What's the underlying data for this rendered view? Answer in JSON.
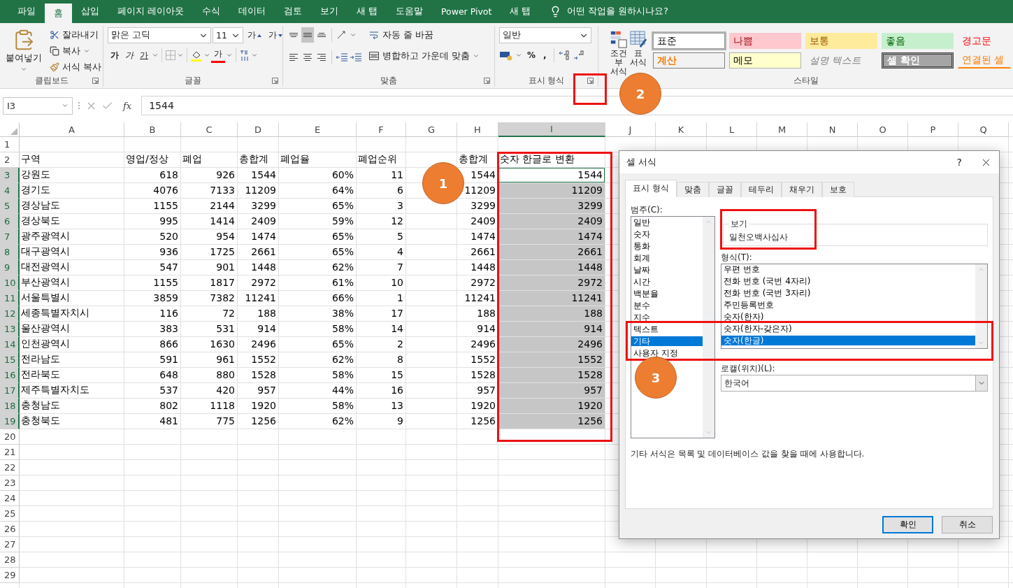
{
  "ribbon_tabs": [
    {
      "label": "파일",
      "selected": false
    },
    {
      "label": "홈",
      "selected": true
    },
    {
      "label": "삽입",
      "selected": false
    },
    {
      "label": "페이지 레이아웃",
      "selected": false
    },
    {
      "label": "수식",
      "selected": false
    },
    {
      "label": "데이터",
      "selected": false
    },
    {
      "label": "검토",
      "selected": false
    },
    {
      "label": "보기",
      "selected": false
    },
    {
      "label": "새 탭",
      "selected": false
    },
    {
      "label": "도움말",
      "selected": false
    },
    {
      "label": "Power Pivot",
      "selected": false
    },
    {
      "label": "새 탭",
      "selected": false
    }
  ],
  "tell_me": "어떤 작업을 원하시나요?",
  "ribbon": {
    "clipboard": {
      "title": "클립보드",
      "paste": "붙여넣기",
      "cut": "잘라내기",
      "copy": "복사",
      "format_painter": "서식 복사"
    },
    "font": {
      "title": "글꼴",
      "font_name": "맑은 고딕",
      "font_size": "11",
      "grow": "가",
      "shrink": "가",
      "bold": "가",
      "italic": "가",
      "underline": "가",
      "font_color": "가"
    },
    "alignment": {
      "title": "맞춤",
      "vertical_align_buttons": [
        {
          "selected": false
        },
        {
          "selected": true
        },
        {
          "selected": false
        }
      ],
      "wrap_text": "자동 줄 바꿈",
      "merge_center": "병합하고 가운데 맞춤"
    },
    "number": {
      "title": "표시 형식",
      "format": "일반",
      "percent": "%",
      "comma": ","
    },
    "styles": {
      "title": "스타일",
      "conditional": "조건부 서식",
      "table": "표 서식",
      "gallery": [
        {
          "label": "표준",
          "kind": "normal",
          "selected": true
        },
        {
          "label": "나쁨",
          "kind": "bad",
          "selected": false
        },
        {
          "label": "보통",
          "kind": "neutral",
          "selected": false
        },
        {
          "label": "좋음",
          "kind": "good",
          "selected": false
        },
        {
          "label": "경고문",
          "kind": "warning",
          "selected": false
        },
        {
          "label": "계산",
          "kind": "calculation",
          "selected": false
        },
        {
          "label": "메모",
          "kind": "note",
          "selected": false
        },
        {
          "label": "설명 텍스트",
          "kind": "explanatory",
          "selected": false
        },
        {
          "label": "셀 확인",
          "kind": "check",
          "selected": false
        },
        {
          "label": "연결된 셀",
          "kind": "linked",
          "selected": false
        }
      ]
    }
  },
  "formula_bar": {
    "name_box": "I3",
    "function_label": "fx",
    "value": "1544"
  },
  "sheet": {
    "columns": [
      {
        "label": "A",
        "selected": false
      },
      {
        "label": "B",
        "selected": false
      },
      {
        "label": "C",
        "selected": false
      },
      {
        "label": "D",
        "selected": false
      },
      {
        "label": "E",
        "selected": false
      },
      {
        "label": "F",
        "selected": false
      },
      {
        "label": "G",
        "selected": false
      },
      {
        "label": "H",
        "selected": false
      },
      {
        "label": "I",
        "selected": true
      },
      {
        "label": "J",
        "selected": false
      },
      {
        "label": "K",
        "selected": false
      },
      {
        "label": "L",
        "selected": false
      },
      {
        "label": "M",
        "selected": false
      },
      {
        "label": "N",
        "selected": false
      },
      {
        "label": "O",
        "selected": false
      },
      {
        "label": "P",
        "selected": false
      },
      {
        "label": "Q",
        "selected": false
      }
    ],
    "rows": [
      {
        "number": "1",
        "kind": "empty",
        "selected": false,
        "active": false
      },
      {
        "number": "2",
        "kind": "header",
        "selected": false,
        "active": false,
        "cells": [
          "구역",
          "영업/정상",
          "폐업",
          "총합계",
          "폐업율",
          "폐업순위"
        ],
        "h": "총합계",
        "i": "숫자 한글로 변환"
      },
      {
        "number": "3",
        "kind": "data",
        "selected": true,
        "active": true,
        "cells": [
          "강원도",
          "618",
          "926",
          "1544",
          "60%",
          "11"
        ],
        "h": "1544",
        "i": "1544"
      },
      {
        "number": "4",
        "kind": "data",
        "selected": true,
        "active": false,
        "cells": [
          "경기도",
          "4076",
          "7133",
          "11209",
          "64%",
          "6"
        ],
        "h": "11209",
        "i": "11209"
      },
      {
        "number": "5",
        "kind": "data",
        "selected": true,
        "active": false,
        "cells": [
          "경상남도",
          "1155",
          "2144",
          "3299",
          "65%",
          "3"
        ],
        "h": "3299",
        "i": "3299"
      },
      {
        "number": "6",
        "kind": "data",
        "selected": true,
        "active": false,
        "cells": [
          "경상북도",
          "995",
          "1414",
          "2409",
          "59%",
          "12"
        ],
        "h": "2409",
        "i": "2409"
      },
      {
        "number": "7",
        "kind": "data",
        "selected": true,
        "active": false,
        "cells": [
          "광주광역시",
          "520",
          "954",
          "1474",
          "65%",
          "5"
        ],
        "h": "1474",
        "i": "1474"
      },
      {
        "number": "8",
        "kind": "data",
        "selected": true,
        "active": false,
        "cells": [
          "대구광역시",
          "936",
          "1725",
          "2661",
          "65%",
          "4"
        ],
        "h": "2661",
        "i": "2661"
      },
      {
        "number": "9",
        "kind": "data",
        "selected": true,
        "active": false,
        "cells": [
          "대전광역시",
          "547",
          "901",
          "1448",
          "62%",
          "7"
        ],
        "h": "1448",
        "i": "1448"
      },
      {
        "number": "10",
        "kind": "data",
        "selected": true,
        "active": false,
        "cells": [
          "부산광역시",
          "1155",
          "1817",
          "2972",
          "61%",
          "10"
        ],
        "h": "2972",
        "i": "2972"
      },
      {
        "number": "11",
        "kind": "data",
        "selected": true,
        "active": false,
        "cells": [
          "서울특별시",
          "3859",
          "7382",
          "11241",
          "66%",
          "1"
        ],
        "h": "11241",
        "i": "11241"
      },
      {
        "number": "12",
        "kind": "data",
        "selected": true,
        "active": false,
        "cells": [
          "세종특별자치시",
          "116",
          "72",
          "188",
          "38%",
          "17"
        ],
        "h": "188",
        "i": "188"
      },
      {
        "number": "13",
        "kind": "data",
        "selected": true,
        "active": false,
        "cells": [
          "울산광역시",
          "383",
          "531",
          "914",
          "58%",
          "14"
        ],
        "h": "914",
        "i": "914"
      },
      {
        "number": "14",
        "kind": "data",
        "selected": true,
        "active": false,
        "cells": [
          "인천광역시",
          "866",
          "1630",
          "2496",
          "65%",
          "2"
        ],
        "h": "2496",
        "i": "2496"
      },
      {
        "number": "15",
        "kind": "data",
        "selected": true,
        "active": false,
        "cells": [
          "전라남도",
          "591",
          "961",
          "1552",
          "62%",
          "8"
        ],
        "h": "1552",
        "i": "1552"
      },
      {
        "number": "16",
        "kind": "data",
        "selected": true,
        "active": false,
        "cells": [
          "전라북도",
          "648",
          "880",
          "1528",
          "58%",
          "15"
        ],
        "h": "1528",
        "i": "1528"
      },
      {
        "number": "17",
        "kind": "data",
        "selected": true,
        "active": false,
        "cells": [
          "제주특별자치도",
          "537",
          "420",
          "957",
          "44%",
          "16"
        ],
        "h": "957",
        "i": "957"
      },
      {
        "number": "18",
        "kind": "data",
        "selected": true,
        "active": false,
        "cells": [
          "충청남도",
          "802",
          "1118",
          "1920",
          "58%",
          "13"
        ],
        "h": "1920",
        "i": "1920"
      },
      {
        "number": "19",
        "kind": "data",
        "selected": true,
        "active": false,
        "cells": [
          "충청북도",
          "481",
          "775",
          "1256",
          "62%",
          "9"
        ],
        "h": "1256",
        "i": "1256"
      },
      {
        "number": "20",
        "kind": "empty",
        "selected": false,
        "active": false
      },
      {
        "number": "21",
        "kind": "empty",
        "selected": false,
        "active": false
      },
      {
        "number": "22",
        "kind": "empty",
        "selected": false,
        "active": false
      },
      {
        "number": "23",
        "kind": "empty",
        "selected": false,
        "active": false
      },
      {
        "number": "24",
        "kind": "empty",
        "selected": false,
        "active": false
      },
      {
        "number": "25",
        "kind": "empty",
        "selected": false,
        "active": false
      },
      {
        "number": "26",
        "kind": "empty",
        "selected": false,
        "active": false
      },
      {
        "number": "27",
        "kind": "empty",
        "selected": false,
        "active": false
      },
      {
        "number": "28",
        "kind": "empty",
        "selected": false,
        "active": false
      },
      {
        "number": "29",
        "kind": "empty",
        "selected": false,
        "active": false
      }
    ]
  },
  "dialog": {
    "title": "셀 서식",
    "help": "?",
    "tabs": [
      {
        "label": "표시 형식",
        "selected": true
      },
      {
        "label": "맞춤",
        "selected": false
      },
      {
        "label": "글꼴",
        "selected": false
      },
      {
        "label": "테두리",
        "selected": false
      },
      {
        "label": "채우기",
        "selected": false
      },
      {
        "label": "보호",
        "selected": false
      }
    ],
    "category_label": "범주(C):",
    "categories": [
      {
        "label": "일반",
        "selected": false
      },
      {
        "label": "숫자",
        "selected": false
      },
      {
        "label": "통화",
        "selected": false
      },
      {
        "label": "회계",
        "selected": false
      },
      {
        "label": "날짜",
        "selected": false
      },
      {
        "label": "시간",
        "selected": false
      },
      {
        "label": "백분율",
        "selected": false
      },
      {
        "label": "분수",
        "selected": false
      },
      {
        "label": "지수",
        "selected": false
      },
      {
        "label": "텍스트",
        "selected": false
      },
      {
        "label": "기타",
        "selected": true
      },
      {
        "label": "사용자 지정",
        "selected": false
      }
    ],
    "sample_label": "보기",
    "sample": "일천오백사십사",
    "type_label": "형식(T):",
    "types": [
      {
        "label": "우편 번호",
        "selected": false
      },
      {
        "label": "전화 번호 (국번 4자리)",
        "selected": false
      },
      {
        "label": "전화 번호 (국번 3자리)",
        "selected": false
      },
      {
        "label": "주민등록번호",
        "selected": false
      },
      {
        "label": "숫자(한자)",
        "selected": false
      },
      {
        "label": "숫자(한자-갖은자)",
        "selected": false
      },
      {
        "label": "숫자(한글)",
        "selected": true
      }
    ],
    "locale_label": "로캘(위치)(L):",
    "locale": "한국어",
    "description": "기타 서식은 목록 및 데이터베이스 값을 찾을 때에 사용합니다.",
    "buttons": [
      {
        "label": "확인",
        "default": true
      },
      {
        "label": "취소",
        "default": false
      }
    ]
  },
  "annotations": [
    {
      "label": "1"
    },
    {
      "label": "2"
    },
    {
      "label": "3"
    }
  ]
}
